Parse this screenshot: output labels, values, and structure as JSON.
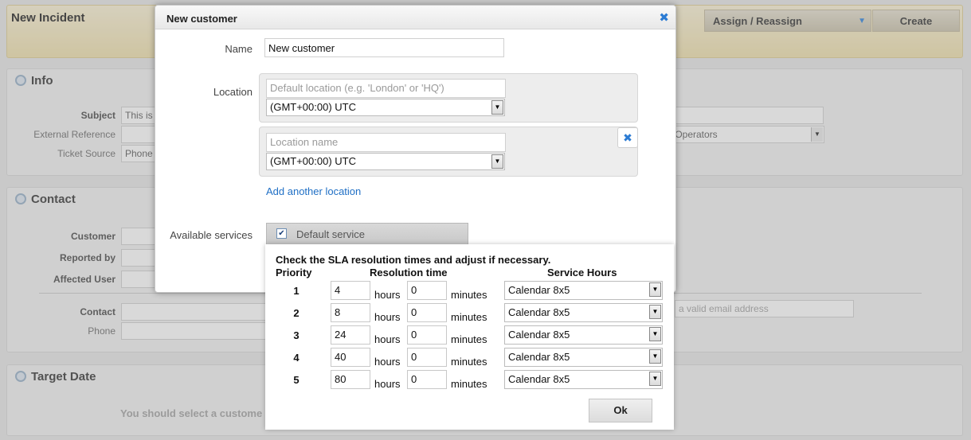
{
  "background": {
    "title": "New Incident",
    "assign_label": "Assign / Reassign",
    "create_label": "Create",
    "info": {
      "title": "Info",
      "subject_label": "Subject",
      "subject_value": "This is",
      "external_ref_label": "External Reference",
      "ticket_source_label": "Ticket Source",
      "ticket_source_value": "Phone",
      "operators_value": ") Operators"
    },
    "contact": {
      "title": "Contact",
      "customer_label": "Customer",
      "reported_by_label": "Reported by",
      "affected_user_label": "Affected User",
      "contact_label": "Contact",
      "phone_label": "Phone",
      "email_placeholder": "a valid email address"
    },
    "target_date": {
      "title": "Target Date",
      "message": "You should select a custome"
    }
  },
  "dialog": {
    "title": "New customer",
    "close_icon": "close-icon",
    "name_label": "Name",
    "name_value": "New customer",
    "location_label": "Location",
    "default_location_placeholder": "Default location (e.g. 'London' or 'HQ')",
    "timezone_1": "(GMT+00:00) UTC",
    "location_name_placeholder": "Location name",
    "timezone_2": "(GMT+00:00) UTC",
    "add_location_link": "Add another location",
    "available_services_label": "Available services",
    "default_service_label": "Default service",
    "default_service_checked": true
  },
  "sla": {
    "instruction": "Check the SLA resolution times and adjust if necessary.",
    "headers": {
      "priority": "Priority",
      "resolution_time": "Resolution time",
      "service_hours": "Service Hours"
    },
    "hours_unit": "hours",
    "minutes_unit": "minutes",
    "rows": [
      {
        "priority": "1",
        "hours": "4",
        "minutes": "0",
        "calendar": "Calendar 8x5"
      },
      {
        "priority": "2",
        "hours": "8",
        "minutes": "0",
        "calendar": "Calendar 8x5"
      },
      {
        "priority": "3",
        "hours": "24",
        "minutes": "0",
        "calendar": "Calendar 8x5"
      },
      {
        "priority": "4",
        "hours": "40",
        "minutes": "0",
        "calendar": "Calendar 8x5"
      },
      {
        "priority": "5",
        "hours": "80",
        "minutes": "0",
        "calendar": "Calendar 8x5"
      }
    ],
    "ok_label": "Ok"
  }
}
